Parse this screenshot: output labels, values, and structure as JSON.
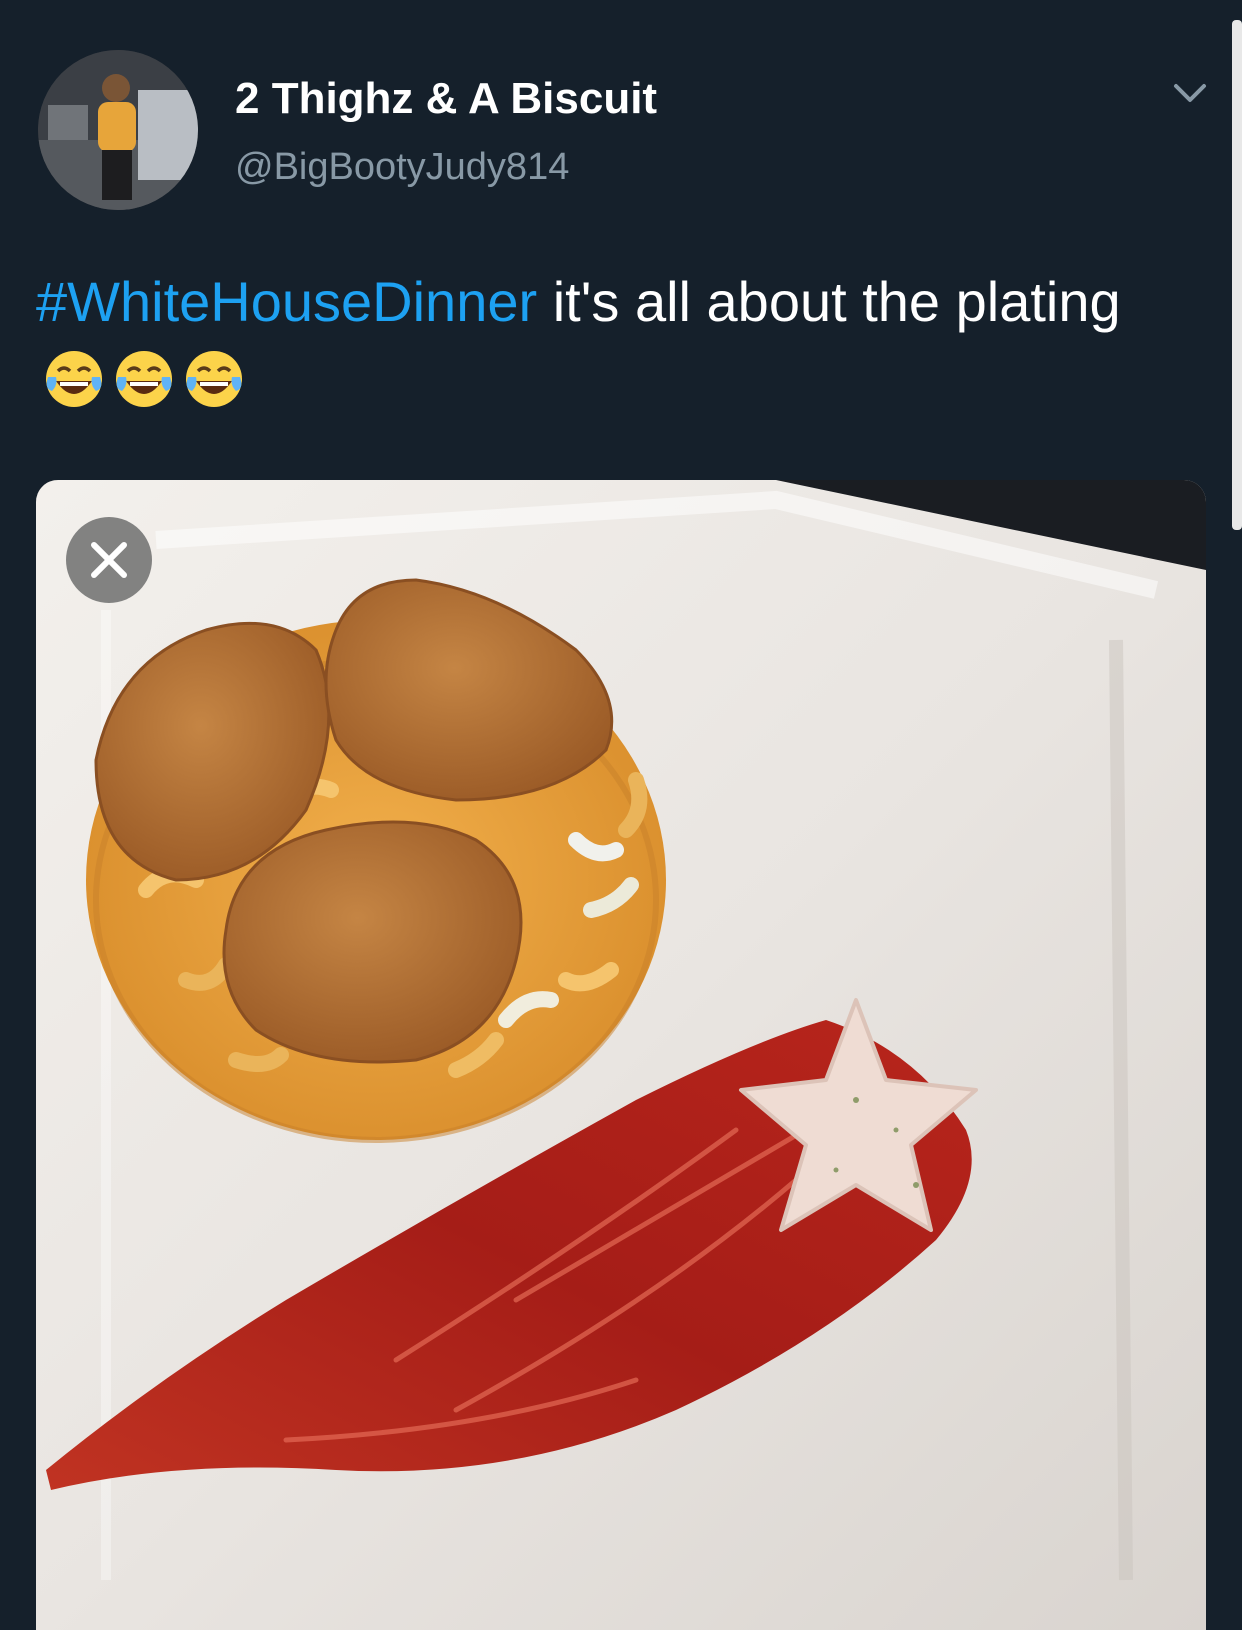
{
  "tweet": {
    "display_name": "2 Thighz & A Biscuit",
    "handle": "@BigBootyJudy814",
    "hashtag": "#WhiteHouseDinner",
    "text_after_hashtag": " it's all about the plating",
    "emojis": [
      "face-with-tears-of-joy-icon",
      "face-with-tears-of-joy-icon",
      "face-with-tears-of-joy-icon"
    ]
  },
  "icons": {
    "menu": "chevron-down-icon",
    "close": "close-icon"
  },
  "colors": {
    "background": "#15202b",
    "link": "#1da1f2",
    "handle": "#8899a6"
  }
}
